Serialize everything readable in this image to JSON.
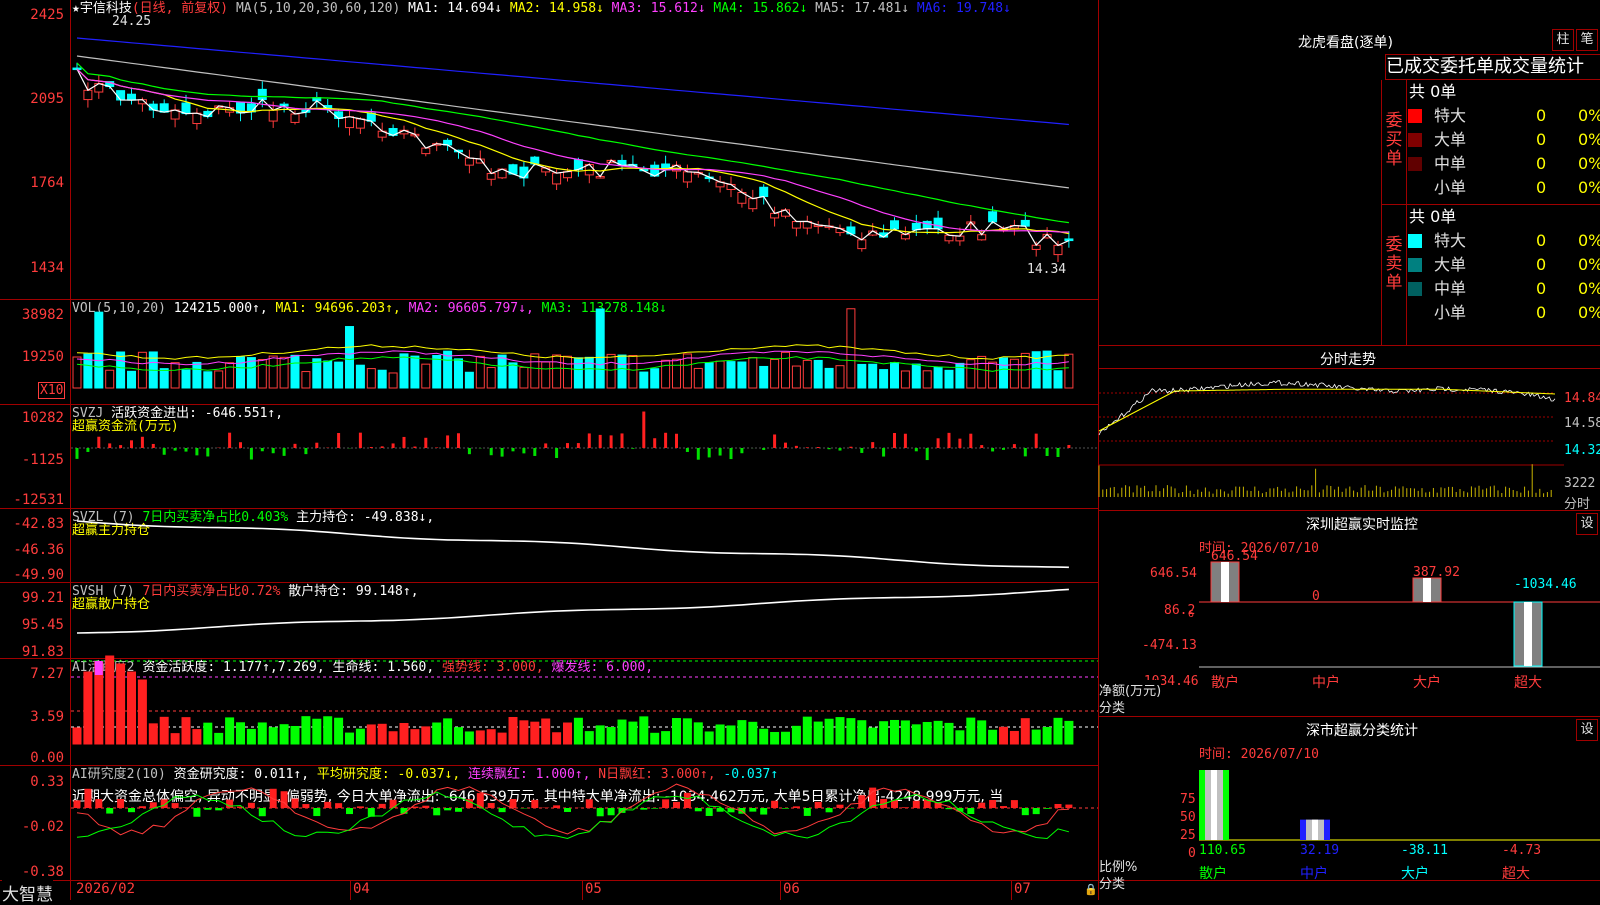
{
  "main": {
    "title": "★宇信科技",
    "period": "(日线, 前复权)",
    "ma_label": "MA(5,10,20,30,60,120)",
    "ma": [
      {
        "label": "MA1: 14.694↓",
        "color": "#ffffff"
      },
      {
        "label": "MA2: 14.958↓",
        "color": "#ffff00"
      },
      {
        "label": "MA3: 15.612↓",
        "color": "#ff40ff"
      },
      {
        "label": "MA4: 15.862↓",
        "color": "#00ff00"
      },
      {
        "label": "MA5: 17.481↓",
        "color": "#c0c0c0"
      },
      {
        "label": "MA6: 19.748↓",
        "color": "#2020ff"
      }
    ],
    "yticks": [
      "2425",
      "2095",
      "1764",
      "1434"
    ],
    "high_label": "24.25",
    "low_label": "14.34"
  },
  "volume": {
    "title": "VOL(5,10,20)",
    "value": "124215.000↑,",
    "ma1": "MA1: 94696.203↑,",
    "ma2": "MA2: 96605.797↓,",
    "ma3": "MA3: 113278.148↓",
    "yticks": [
      "38982",
      "19250"
    ],
    "unit": "X10"
  },
  "svzj": {
    "title": "SVZJ",
    "label": "活跃资金进出: -646.551↑,",
    "subtitle": "超赢资金流(万元)",
    "yticks": [
      "10282",
      "-1125",
      "-12531"
    ]
  },
  "svzl": {
    "title": "SVZL (7)",
    "label1": "7日内买卖净占比0.403%",
    "label2": "主力持仓: -49.838↓,",
    "subtitle": "超赢主力持仓",
    "yticks": [
      "-42.83",
      "-46.36",
      "-49.90"
    ]
  },
  "svsh": {
    "title": "SVSH (7)",
    "label1": "7日内买卖净占比0.72%",
    "label2": "散户持仓: 99.148↑,",
    "subtitle": "超赢散户持仓",
    "yticks": [
      "99.21",
      "95.45",
      "91.83"
    ]
  },
  "ai_active": {
    "title": "AI活跃度2",
    "label1": "资金活跃度: 1.177↑,7.269,",
    "label2": "生命线: 1.560,",
    "label3": "强势线: 3.000,",
    "label4": "爆发线: 6.000,",
    "yticks": [
      "7.27",
      "3.59",
      "0.00"
    ]
  },
  "ai_research": {
    "title": "AI研究度2(10)",
    "label1": "资金研究度: 0.011↑,",
    "label2": "平均研究度: -0.037↓,",
    "label3": "连续飘红: 1.000↑,",
    "label4": "N日飘红: 3.000↑,",
    "label5": "-0.037↑",
    "summary": "近期大资金总体偏空, 异动不明显, 偏弱势, 今日大单净流出: -646.539万元, 其中特大单净流出: -1034.462万元, 大单5日累计净出-4248.999万元, 当",
    "yticks": [
      "0.33",
      "-0.02",
      "-0.38"
    ]
  },
  "xaxis": {
    "labels": [
      "2026/02",
      "04",
      "05",
      "06",
      "07"
    ]
  },
  "bottom_brand": "大智慧",
  "right": {
    "dragon_title": "龙虎看盘(逐单)",
    "btn_bar": "柱",
    "btn_stroke": "笔",
    "tabs_label": "已成交委托单成交量统计",
    "buy": {
      "side_label": "委买单",
      "total": "共 0单",
      "rows": [
        {
          "name": "特大",
          "count": "0",
          "pct": "0%",
          "color": "#ff0000"
        },
        {
          "name": "大单",
          "count": "0",
          "pct": "0%",
          "color": "#800000"
        },
        {
          "name": "中单",
          "count": "0",
          "pct": "0%",
          "color": "#600000"
        },
        {
          "name": "小单",
          "count": "0",
          "pct": "0%",
          "color": "#000000"
        }
      ]
    },
    "sell": {
      "side_label": "委卖单",
      "total": "共 0单",
      "rows": [
        {
          "name": "特大",
          "count": "0",
          "pct": "0%",
          "color": "#00ffff"
        },
        {
          "name": "大单",
          "count": "0",
          "pct": "0%",
          "color": "#008080"
        },
        {
          "name": "中单",
          "count": "0",
          "pct": "0%",
          "color": "#006060"
        },
        {
          "name": "小单",
          "count": "0",
          "pct": "0%",
          "color": "#000000"
        }
      ]
    },
    "intraday": {
      "title": "分时走势",
      "header": "",
      "yticks": [
        "14.84",
        "14.58",
        "14.32"
      ],
      "vol_tick": "3222",
      "vol_label": "分时"
    },
    "sz_monitor": {
      "title": "深圳超赢实时监控",
      "btn": "设",
      "time": "时间: 2026/07/10",
      "yticks": [
        "646.54",
        "86.2",
        "-474.13",
        "-1034.46",
        "6"
      ],
      "ylabel": "净额(万元)",
      "xlabel": "分类",
      "categories": [
        "散户",
        "中户",
        "大户",
        "超大"
      ],
      "values": [
        646.54,
        0,
        387.92,
        -1034.46
      ],
      "value_labels": [
        "646.54",
        "0",
        "387.92",
        "-1034.46"
      ]
    },
    "sz_class": {
      "title": "深市超赢分类统计",
      "btn": "设",
      "time": "时间: 2026/07/10",
      "yticks": [
        "75",
        "50",
        "25",
        "0"
      ],
      "ylabel": "比例%",
      "xlabel": "分类",
      "categories": [
        "散户",
        "中户",
        "大户",
        "超大"
      ],
      "values": [
        110.65,
        32.19,
        -38.11,
        -4.73
      ],
      "value_labels": [
        "110.65",
        "32.19",
        "-38.11",
        "-4.73"
      ]
    }
  }
}
